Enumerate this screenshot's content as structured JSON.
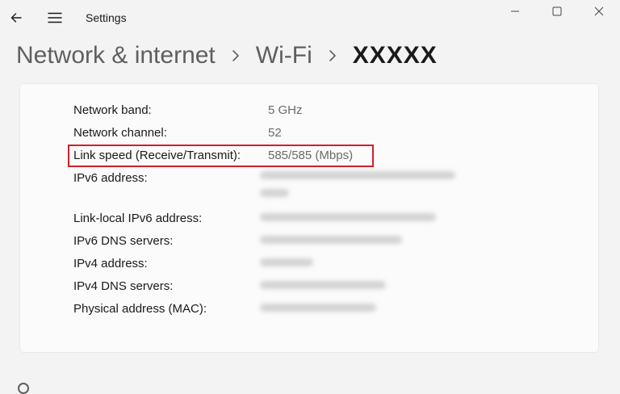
{
  "titlebar": {
    "app_title": "Settings",
    "back_icon": "back-arrow-icon",
    "menu_icon": "hamburger-menu-icon",
    "minimize_icon": "minimize-icon",
    "maximize_icon": "maximize-icon",
    "close_icon": "close-icon"
  },
  "breadcrumb": {
    "items": [
      "Network & internet",
      "Wi-Fi"
    ],
    "current": "XXXXX",
    "separator_icon": "chevron-right-icon"
  },
  "properties": [
    {
      "label": "Network band:",
      "value": "5 GHz"
    },
    {
      "label": "Network channel:",
      "value": "52"
    },
    {
      "label": "Link speed (Receive/Transmit):",
      "value": "585/585 (Mbps)"
    },
    {
      "label": "IPv6 address:",
      "value": ""
    },
    {
      "label": "Link-local IPv6 address:",
      "value": ""
    },
    {
      "label": "IPv6 DNS servers:",
      "value": ""
    },
    {
      "label": "IPv4 address:",
      "value": ""
    },
    {
      "label": "IPv4 DNS servers:",
      "value": ""
    },
    {
      "label": "Physical address (MAC):",
      "value": ""
    }
  ],
  "colors": {
    "highlight": "#d0202a",
    "background": "#f3f3f3",
    "card": "#fbfbfb"
  }
}
